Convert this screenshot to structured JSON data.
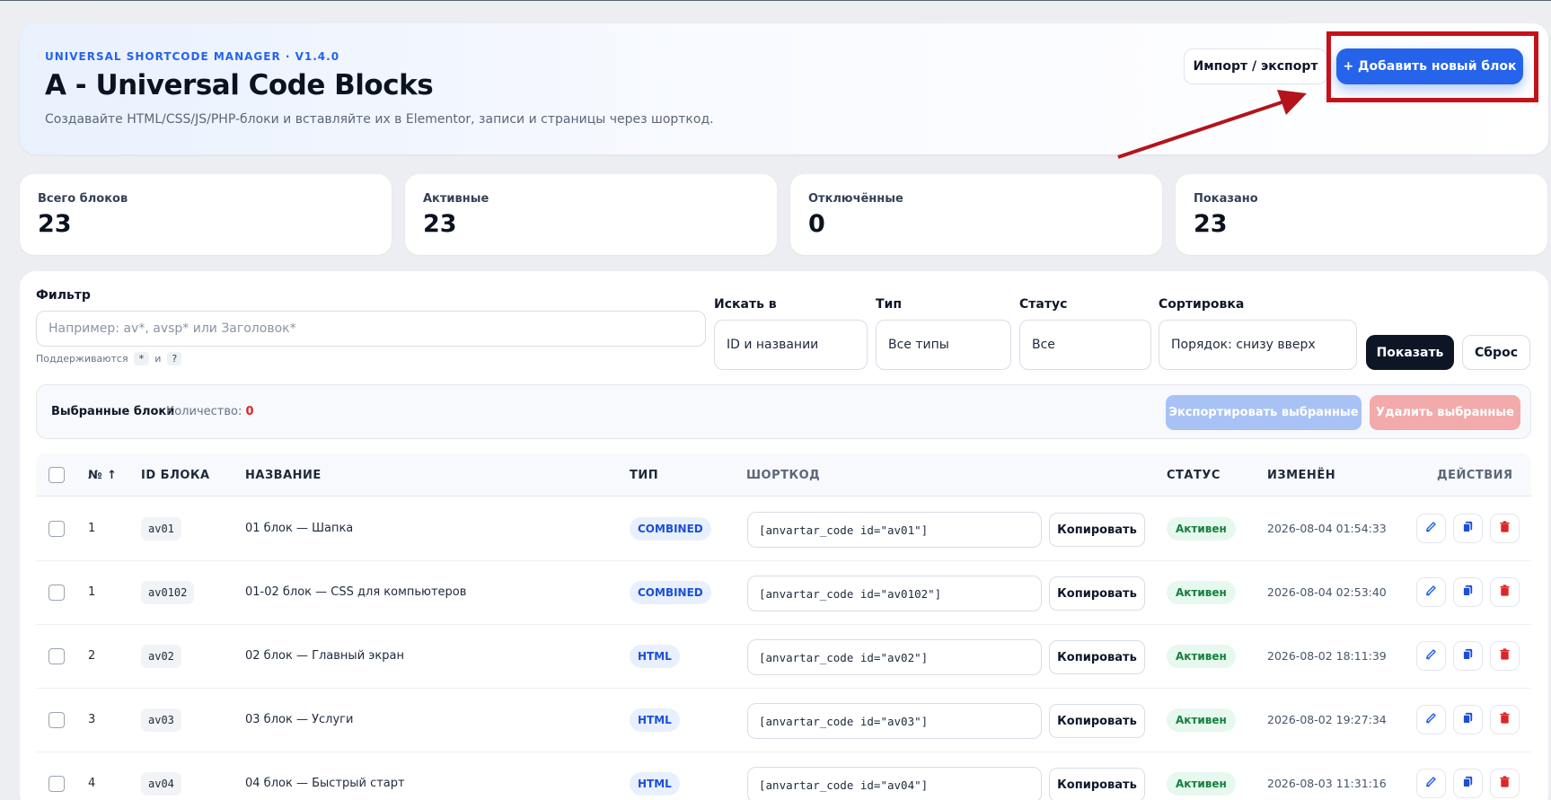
{
  "header": {
    "eyebrow": "UNIVERSAL SHORTCODE MANAGER · V1.4.0",
    "title": "A - Universal Code Blocks",
    "subtitle": "Создавайте HTML/CSS/JS/PHP-блоки и вставляйте их в Elementor, записи и страницы через шорткод.",
    "import_label": "Импорт / экспорт",
    "add_label": "+ Добавить новый блок"
  },
  "stats": [
    {
      "label": "Всего блоков",
      "value": "23"
    },
    {
      "label": "Активные",
      "value": "23"
    },
    {
      "label": "Отключённые",
      "value": "0"
    },
    {
      "label": "Показано",
      "value": "23"
    }
  ],
  "filters": {
    "filter_label": "Фильтр",
    "filter_placeholder": "Например: av*, avsp* или Заголовок*",
    "hint_prefix": "Поддерживаются",
    "hint_star": "*",
    "hint_and": "и",
    "hint_q": "?",
    "search_in_label": "Искать в",
    "search_in_value": "ID и названии",
    "type_label": "Тип",
    "type_value": "Все типы",
    "status_label": "Статус",
    "status_value": "Все",
    "sort_label": "Сортировка",
    "sort_value": "Порядок: снизу вверх",
    "show_label": "Показать",
    "reset_label": "Сброс"
  },
  "selection": {
    "title": "Выбранные блоки",
    "count_label": "Количество:",
    "count": "0",
    "export_label": "Экспортировать выбранные",
    "delete_label": "Удалить выбранные"
  },
  "table": {
    "headers": {
      "num": "№ ↑",
      "id": "ID БЛОКА",
      "name": "НАЗВАНИЕ",
      "type": "ТИП",
      "shortcode": "ШОРТКОД",
      "status": "СТАТУС",
      "modified": "ИЗМЕНЁН",
      "actions": "ДЕЙСТВИЯ"
    },
    "copy_label": "Копировать",
    "rows": [
      {
        "num": "1",
        "id": "av01",
        "name": "01 блок — Шапка",
        "type": "COMBINED",
        "shortcode": "[anvartar_code id=\"av01\"]",
        "status": "Активен",
        "modified": "2026-08-04 01:54:33"
      },
      {
        "num": "1",
        "id": "av0102",
        "name": "01-02 блок — CSS для компьютеров",
        "type": "COMBINED",
        "shortcode": "[anvartar_code id=\"av0102\"]",
        "status": "Активен",
        "modified": "2026-08-04 02:53:40"
      },
      {
        "num": "2",
        "id": "av02",
        "name": "02 блок — Главный экран",
        "type": "HTML",
        "shortcode": "[anvartar_code id=\"av02\"]",
        "status": "Активен",
        "modified": "2026-08-02 18:11:39"
      },
      {
        "num": "3",
        "id": "av03",
        "name": "03 блок — Услуги",
        "type": "HTML",
        "shortcode": "[anvartar_code id=\"av03\"]",
        "status": "Активен",
        "modified": "2026-08-02 19:27:34"
      },
      {
        "num": "4",
        "id": "av04",
        "name": "04 блок — Быстрый старт",
        "type": "HTML",
        "shortcode": "[anvartar_code id=\"av04\"]",
        "status": "Активен",
        "modified": "2026-08-03 11:31:16"
      }
    ]
  },
  "colors": {
    "accent": "#2563eb",
    "danger": "#dc2626",
    "success": "#15803d",
    "annotation": "#c5121a"
  }
}
